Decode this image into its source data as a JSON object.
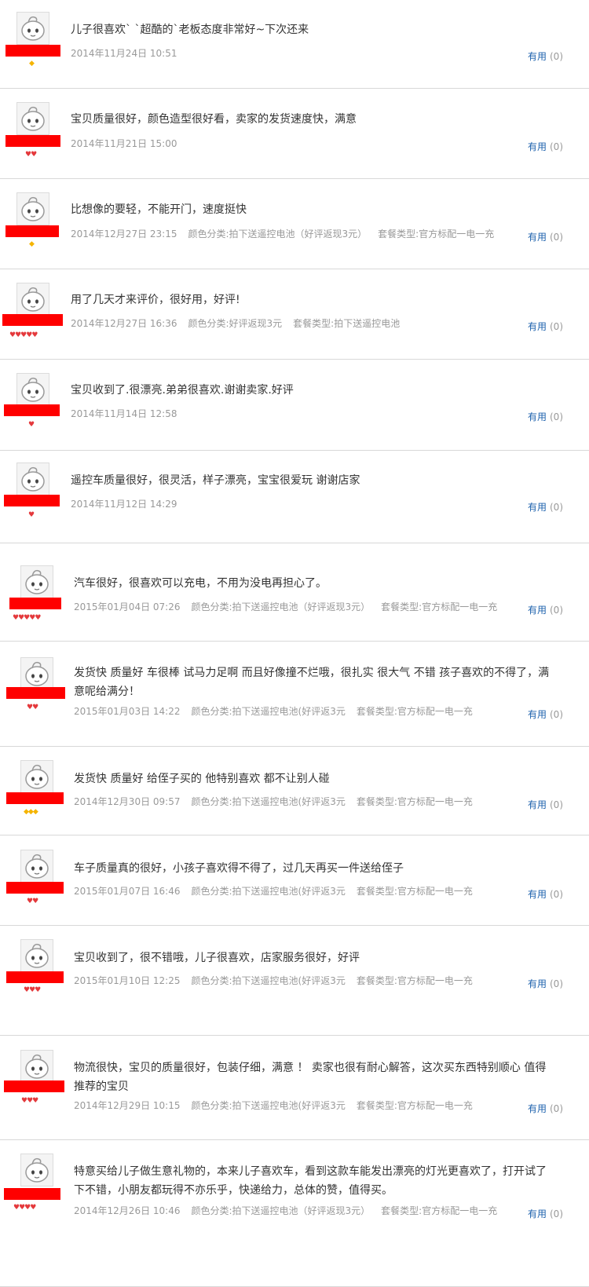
{
  "reviews": [
    {
      "text": "儿子很喜欢` `超酷的`老板态度非常好~下次还来",
      "date": "2014年11月24日 10:51",
      "color": "",
      "package": "",
      "useful": "有用",
      "count": "(0)",
      "badge": "gold",
      "level": 1
    },
    {
      "text": "宝贝质量很好，颜色造型很好看，卖家的发货速度快，满意",
      "date": "2014年11月21日 15:00",
      "color": "",
      "package": "",
      "useful": "有用",
      "count": "(0)",
      "badge": "red",
      "level": 2
    },
    {
      "text": "比想像的要轻，不能开门，速度挺快",
      "date": "2014年12月27日 23:15",
      "color": "颜色分类:拍下送遥控电池（好评返现3元）",
      "package": "套餐类型:官方标配一电一充",
      "useful": "有用",
      "count": "(0)",
      "badge": "gold",
      "level": 1
    },
    {
      "text": "用了几天才来评价，很好用，好评!",
      "date": "2014年12月27日 16:36",
      "color": "颜色分类:好评返现3元",
      "package": "套餐类型:拍下送遥控电池",
      "useful": "有用",
      "count": "(0)",
      "badge": "red",
      "level": 5
    },
    {
      "text": "宝贝收到了.很漂亮.弟弟很喜欢.谢谢卖家.好评",
      "date": "2014年11月14日 12:58",
      "color": "",
      "package": "",
      "useful": "有用",
      "count": "(0)",
      "badge": "red",
      "level": 1
    },
    {
      "text": "遥控车质量很好，很灵活，样子漂亮，宝宝很爱玩 谢谢店家",
      "date": "2014年11月12日 14:29",
      "color": "",
      "package": "",
      "useful": "有用",
      "count": "(0)",
      "badge": "red",
      "level": 1
    },
    {
      "text": "汽车很好，很喜欢可以充电，不用为没电再担心了。",
      "date": "2015年01月04日 07:26",
      "color": "颜色分类:拍下送遥控电池（好评返现3元）",
      "package": "套餐类型:官方标配一电一充",
      "useful": "有用",
      "count": "(0)",
      "badge": "red",
      "level": 5
    },
    {
      "text": "发货快 质量好 车很棒 试马力足啊 而且好像撞不烂哦，很扎实 很大气 不错 孩子喜欢的不得了，满意呢给满分！",
      "date": "2015年01月03日 14:22",
      "color": "颜色分类:拍下送遥控电池(好评返3元",
      "package": "套餐类型:官方标配一电一充",
      "useful": "有用",
      "count": "(0)",
      "badge": "red",
      "level": 2
    },
    {
      "text": "发货快 质量好 给侄子买的 他特别喜欢 都不让别人碰",
      "date": "2014年12月30日 09:57",
      "color": "颜色分类:拍下送遥控电池(好评返3元",
      "package": "套餐类型:官方标配一电一充",
      "useful": "有用",
      "count": "(0)",
      "badge": "gold",
      "level": 3
    },
    {
      "text": "车子质量真的很好，小孩子喜欢得不得了，过几天再买一件送给侄子",
      "date": "2015年01月07日 16:46",
      "color": "颜色分类:拍下送遥控电池(好评返3元",
      "package": "套餐类型:官方标配一电一充",
      "useful": "有用",
      "count": "(0)",
      "badge": "red",
      "level": 2
    },
    {
      "text": "宝贝收到了，很不错哦，儿子很喜欢，店家服务很好，好评",
      "date": "2015年01月10日 12:25",
      "color": "颜色分类:拍下送遥控电池(好评返3元",
      "package": "套餐类型:官方标配一电一充",
      "useful": "有用",
      "count": "(0)",
      "badge": "red",
      "level": 3
    },
    {
      "text": "物流很快，宝贝的质量很好，包装仔细，满意 ！ 卖家也很有耐心解答，这次买东西特别顺心 值得推荐的宝贝",
      "date": "2014年12月29日 10:15",
      "color": "颜色分类:拍下送遥控电池(好评返3元",
      "package": "套餐类型:官方标配一电一充",
      "useful": "有用",
      "count": "(0)",
      "badge": "red",
      "level": 3
    },
    {
      "text": "特意买给儿子做生意礼物的，本来儿子喜欢车，看到这款车能发出漂亮的灯光更喜欢了，打开试了下不错，小朋友都玩得不亦乐乎，快递给力，总体的赞，值得买。",
      "date": "2014年12月26日 10:46",
      "color": "颜色分类:拍下送遥控电池（好评返现3元）",
      "package": "套餐类型:官方标配一电一充",
      "useful": "有用",
      "count": "(0)",
      "badge": "red",
      "level": 4
    }
  ]
}
